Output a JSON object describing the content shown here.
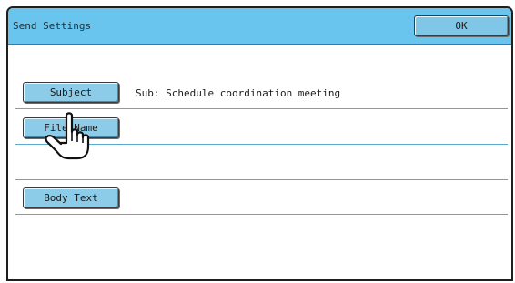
{
  "window": {
    "title": "Send Settings",
    "ok_label": "OK"
  },
  "rows": [
    {
      "button_label": "Subject",
      "value": "Sub: Schedule coordination meeting"
    },
    {
      "button_label": "File Name",
      "value": ""
    },
    {
      "button_label": "",
      "value": ""
    },
    {
      "button_label": "Body Text",
      "value": ""
    }
  ],
  "colors": {
    "titlebar": "#69c5ee",
    "button": "#8ccce8",
    "divider": "#5aa9cf"
  },
  "icons": {
    "pointer": "hand-pointer-icon"
  }
}
